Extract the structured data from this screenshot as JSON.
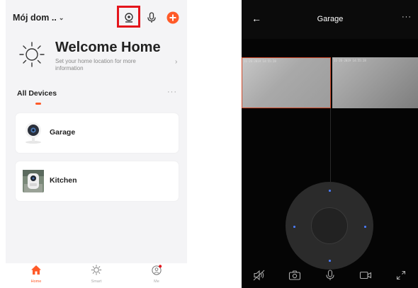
{
  "left_app": {
    "home_name": "Mój dom ..",
    "welcome": {
      "title": "Welcome Home",
      "subtitle": "Set your home location for more information"
    },
    "tabs": {
      "all_devices": "All Devices",
      "more": "···"
    },
    "devices": [
      {
        "name": "Garage",
        "icon": "camera-device-icon"
      },
      {
        "name": "Kitchen",
        "icon": "outdoor-camera-icon"
      }
    ],
    "nav": [
      {
        "label": "Home",
        "icon": "home-icon",
        "active": true
      },
      {
        "label": "Smart",
        "icon": "sun-icon",
        "active": false
      },
      {
        "label": "Me",
        "icon": "profile-icon",
        "active": false
      }
    ],
    "accent_color": "#ff5a28",
    "highlight_color": "#e4151c"
  },
  "right_app": {
    "title": "Garage",
    "more": "···",
    "feed_timestamps": [
      "11-26-2019 14:55:28",
      "11-26-2019 14:55:28"
    ],
    "toolbar": [
      "mute-icon",
      "snapshot-icon",
      "microphone-icon",
      "record-icon",
      "fullscreen-icon"
    ],
    "ptz_accent": "#4b7cff"
  }
}
